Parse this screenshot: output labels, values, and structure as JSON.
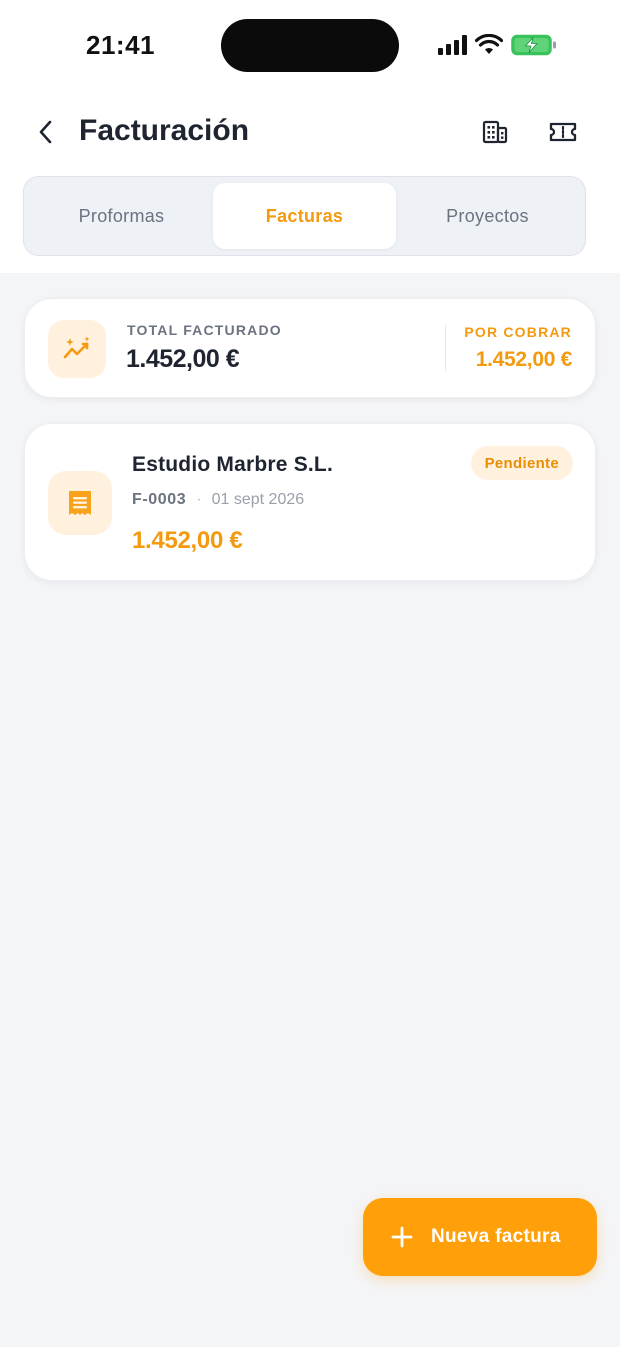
{
  "status_bar": {
    "time": "21:41"
  },
  "header": {
    "title": "Facturación"
  },
  "tabs": [
    {
      "label": "Proformas",
      "active": false
    },
    {
      "label": "Facturas",
      "active": true
    },
    {
      "label": "Proyectos",
      "active": false
    }
  ],
  "summary": {
    "total_label": "TOTAL FACTURADO",
    "total_value": "1.452,00 €",
    "due_label": "POR COBRAR",
    "due_value": "1.452,00 €"
  },
  "invoices": [
    {
      "client": "Estudio Marbre S.L.",
      "number": "F-0003",
      "separator": "·",
      "date": "01 sept 2026",
      "amount": "1.452,00 €",
      "status": "Pendiente"
    }
  ],
  "fab": {
    "label": "Nueva factura"
  },
  "colors": {
    "accent": "#ff9f0a",
    "accent_text": "#f39a0f",
    "accent_soft": "#fff1de",
    "text_primary": "#1e2430",
    "text_secondary": "#6b7280",
    "background": "#f4f5f7"
  },
  "icons": {
    "back": "chevron-left-icon",
    "company": "building-icon",
    "ticket": "ticket-icon",
    "trend": "trend-sparkle-icon",
    "invoice": "receipt-icon",
    "add": "plus-icon"
  }
}
